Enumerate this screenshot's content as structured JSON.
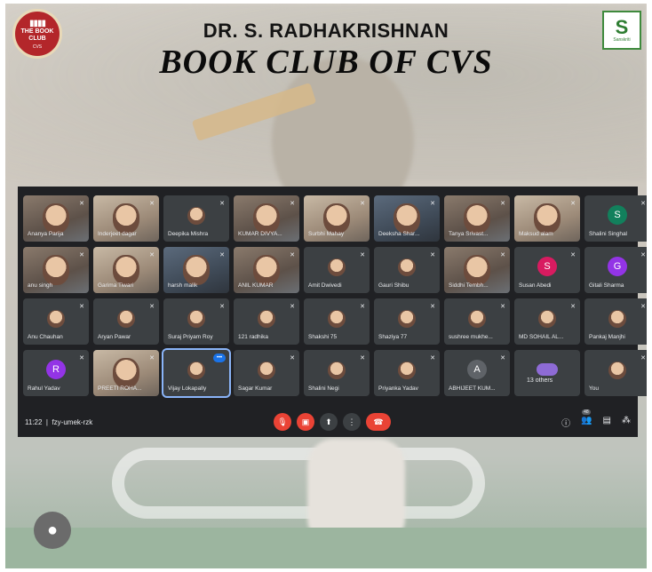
{
  "header": {
    "line1": "DR. S. RADHAKRISHNAN",
    "line2": "BOOK CLUB OF CVS",
    "logo_left_text": "THE BOOK CLUB",
    "logo_left_sub": "CVS",
    "logo_right_caption": "Sanskriti"
  },
  "meet": {
    "tiles": [
      {
        "name": "Ananya Parija",
        "kind": "video"
      },
      {
        "name": "Inderjeet dagar",
        "kind": "video"
      },
      {
        "name": "Deepika Mishra",
        "kind": "photo"
      },
      {
        "name": "KUMAR DIVYA...",
        "kind": "video"
      },
      {
        "name": "Surbhi Mahay",
        "kind": "video"
      },
      {
        "name": "Deeksha Shar...",
        "kind": "video"
      },
      {
        "name": "Tanya Srivast...",
        "kind": "video"
      },
      {
        "name": "Maksud alam",
        "kind": "video"
      },
      {
        "name": "Shalini Singhal",
        "kind": "avatar",
        "letter": "S",
        "color": "#12805c"
      },
      {
        "name": "anu singh",
        "kind": "video"
      },
      {
        "name": "Garima Tiwari",
        "kind": "video"
      },
      {
        "name": "harsh malik",
        "kind": "video"
      },
      {
        "name": "ANIL KUMAR",
        "kind": "video"
      },
      {
        "name": "Amit Dwivedi",
        "kind": "photo"
      },
      {
        "name": "Gauri Shibu",
        "kind": "photo"
      },
      {
        "name": "Siddhi Tembh...",
        "kind": "video"
      },
      {
        "name": "Susan Abedi",
        "kind": "avatar",
        "letter": "S",
        "color": "#d81b60"
      },
      {
        "name": "Gitali Sharma",
        "kind": "avatar",
        "letter": "G",
        "color": "#9334e6"
      },
      {
        "name": "Anu Chauhan",
        "kind": "photo"
      },
      {
        "name": "Aryan Pawar",
        "kind": "photo"
      },
      {
        "name": "Suraj Priyam Roy",
        "kind": "photo"
      },
      {
        "name": "121 radhika",
        "kind": "photo"
      },
      {
        "name": "Shakshi 75",
        "kind": "photo"
      },
      {
        "name": "Shaziya 77",
        "kind": "photo"
      },
      {
        "name": "sushree mukhe...",
        "kind": "photo"
      },
      {
        "name": "MD SOHAIL AL...",
        "kind": "photo"
      },
      {
        "name": "Pankaj Manjhi",
        "kind": "photo"
      },
      {
        "name": "Rahul Yadav",
        "kind": "avatar",
        "letter": "R",
        "color": "#9334e6"
      },
      {
        "name": "PREETI ROHA...",
        "kind": "video"
      },
      {
        "name": "Vijay Lokapally",
        "kind": "photo",
        "active": true
      },
      {
        "name": "Sagar Kumar",
        "kind": "photo"
      },
      {
        "name": "Shalini Negi",
        "kind": "photo"
      },
      {
        "name": "Priyanka Yadav",
        "kind": "photo"
      },
      {
        "name": "ABHIJEET KUM...",
        "kind": "avatar",
        "letter": "A",
        "color": "#5f6368"
      },
      {
        "name": "13 others",
        "kind": "others"
      },
      {
        "name": "You",
        "kind": "photo"
      }
    ],
    "time": "11:22",
    "meeting_code": "fzy-umek-rzk",
    "people_count": "48"
  },
  "colors": {
    "meet_bg": "#202124",
    "tile_bg": "#3c4043",
    "red": "#ea4335"
  }
}
